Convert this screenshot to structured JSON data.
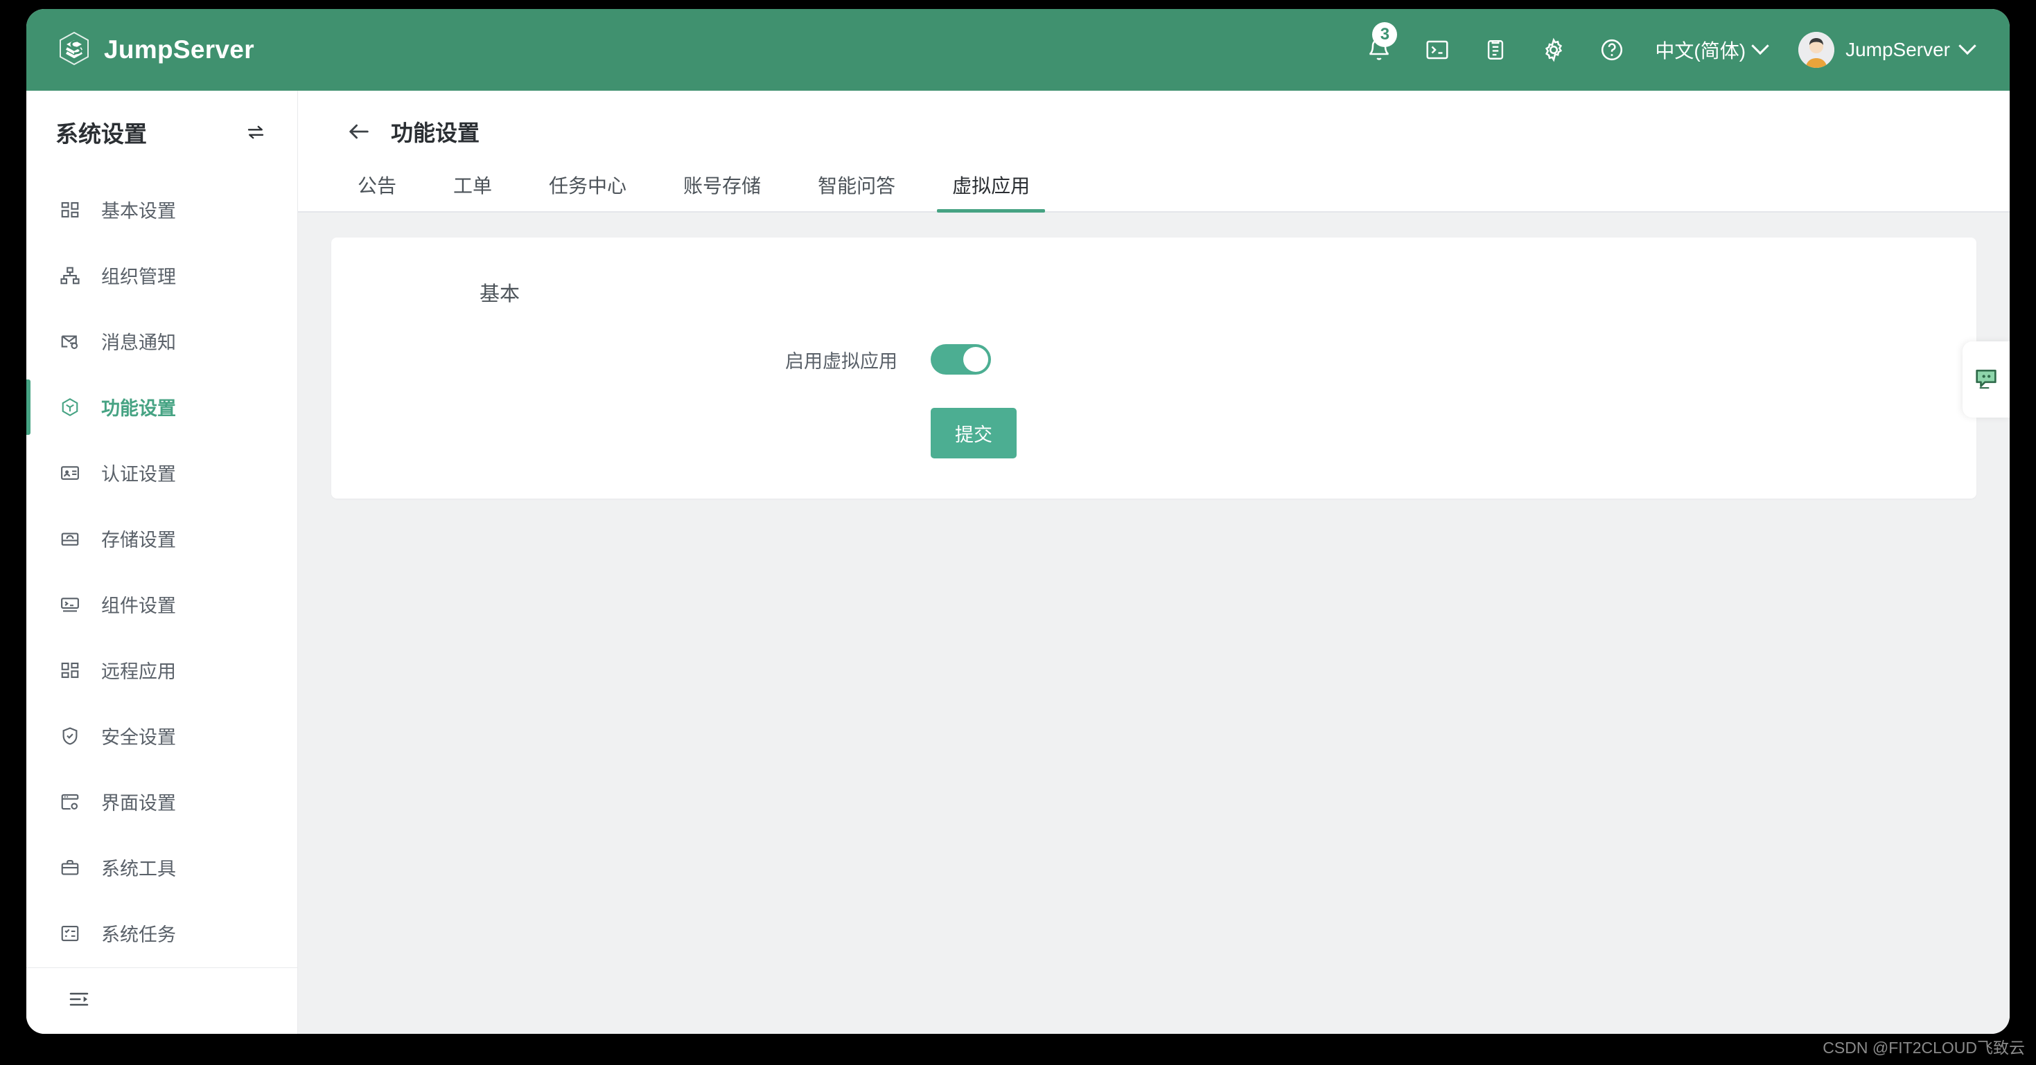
{
  "topbar": {
    "brand": "JumpServer",
    "notifications_badge": "3",
    "language": "中文(简体)",
    "user": "JumpServer",
    "icons": [
      "bell-icon",
      "terminal-icon",
      "document-icon",
      "gear-icon",
      "help-icon"
    ],
    "accent": "#40916f"
  },
  "sidebar": {
    "title": "系统设置",
    "items": [
      {
        "label": "基本设置",
        "icon": "grid-icon",
        "active": false
      },
      {
        "label": "组织管理",
        "icon": "org-tree-icon",
        "active": false
      },
      {
        "label": "消息通知",
        "icon": "mail-gear-icon",
        "active": false
      },
      {
        "label": "功能设置",
        "icon": "cube-icon",
        "active": true
      },
      {
        "label": "认证设置",
        "icon": "id-card-icon",
        "active": false
      },
      {
        "label": "存储设置",
        "icon": "inbox-icon",
        "active": false
      },
      {
        "label": "组件设置",
        "icon": "terminal-window-icon",
        "active": false
      },
      {
        "label": "远程应用",
        "icon": "layout-grid-icon",
        "active": false
      },
      {
        "label": "安全设置",
        "icon": "shield-check-icon",
        "active": false
      },
      {
        "label": "界面设置",
        "icon": "window-gear-icon",
        "active": false
      },
      {
        "label": "系统工具",
        "icon": "toolbox-icon",
        "active": false
      },
      {
        "label": "系统任务",
        "icon": "checklist-icon",
        "active": false
      }
    ]
  },
  "main": {
    "page_title": "功能设置",
    "tabs": [
      {
        "label": "公告",
        "active": false
      },
      {
        "label": "工单",
        "active": false
      },
      {
        "label": "任务中心",
        "active": false
      },
      {
        "label": "账号存储",
        "active": false
      },
      {
        "label": "智能问答",
        "active": false
      },
      {
        "label": "虚拟应用",
        "active": true
      }
    ],
    "card": {
      "section_title": "基本",
      "toggle_label": "启用虚拟应用",
      "toggle_state": "on",
      "submit_label": "提交"
    },
    "accent": "#46a383"
  },
  "chat": {
    "icon": "chat-bubble-icon"
  },
  "watermark": "CSDN @FIT2CLOUD飞致云"
}
